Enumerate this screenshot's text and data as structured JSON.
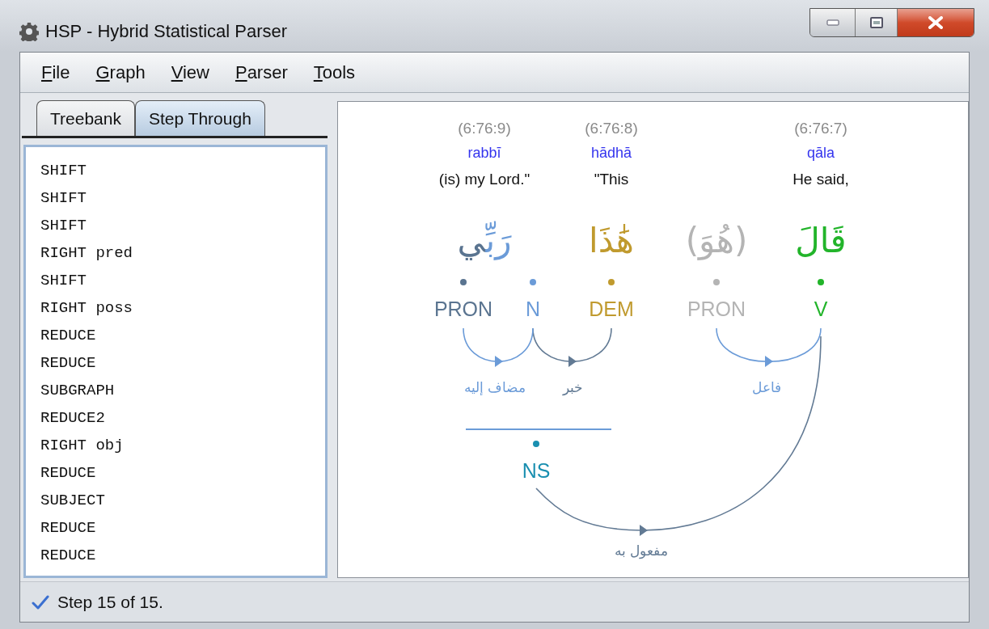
{
  "window": {
    "title": "HSP - Hybrid Statistical Parser"
  },
  "menu": [
    "File",
    "Graph",
    "View",
    "Parser",
    "Tools"
  ],
  "tabs": [
    {
      "label": "Treebank",
      "selected": false
    },
    {
      "label": "Step Through",
      "selected": true
    }
  ],
  "steps": [
    "SHIFT",
    "SHIFT",
    "SHIFT",
    "RIGHT pred",
    "SHIFT",
    "RIGHT poss",
    "REDUCE",
    "REDUCE",
    "SUBGRAPH",
    "REDUCE2",
    "RIGHT obj",
    "REDUCE",
    "SUBJECT",
    "REDUCE",
    "REDUCE"
  ],
  "graph": {
    "tokens": [
      {
        "location": "(6:76:9)",
        "translit": "rabbī",
        "gloss": "(is) my Lord.\"",
        "segments": [
          {
            "text": "رَبِّ",
            "color": "#6b9bd8"
          },
          {
            "text": "ي",
            "color": "#5a7490"
          }
        ]
      },
      {
        "location": "(6:76:8)",
        "translit": "hādhā",
        "gloss": "\"This",
        "segments": [
          {
            "text": "هَٰذَا",
            "color": "#c09a2e"
          }
        ]
      },
      {
        "segments": [
          {
            "text": "(هُوَ)",
            "color": "#b4b4b4"
          }
        ]
      },
      {
        "location": "(6:76:7)",
        "translit": "qāla",
        "gloss": "He said,",
        "segments": [
          {
            "text": "قَالَ",
            "color": "#22b42a"
          }
        ]
      }
    ],
    "nodes": [
      {
        "tag": "PRON",
        "color": "#5a7490"
      },
      {
        "tag": "N",
        "color": "#6b9bd8"
      },
      {
        "tag": "DEM",
        "color": "#c09a2e"
      },
      {
        "tag": "PRON",
        "color": "#b4b4b4"
      },
      {
        "tag": "V",
        "color": "#22b42a"
      }
    ],
    "edges": [
      {
        "label": "فاعل",
        "color": "#6b9bd8"
      },
      {
        "label": "خبر",
        "color": "#627a94"
      },
      {
        "label": "مضاف إليه",
        "color": "#6b9bd8"
      },
      {
        "label": "مفعول به",
        "color": "#627a94"
      }
    ],
    "phrase": {
      "tag": "NS",
      "color": "#1a8fb0"
    }
  },
  "status": {
    "text": "Step 15 of 15."
  }
}
